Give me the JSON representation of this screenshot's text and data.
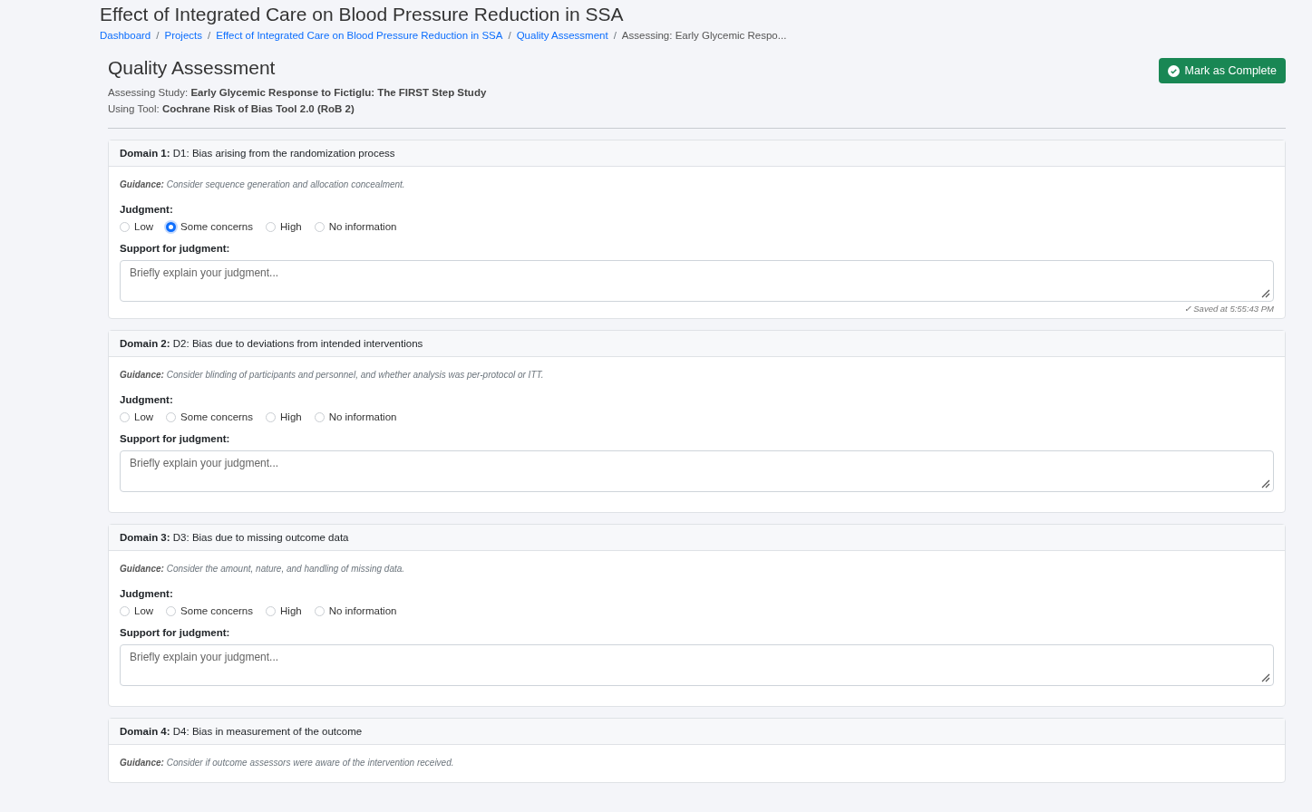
{
  "page_title": "Effect of Integrated Care on Blood Pressure Reduction in SSA",
  "breadcrumb": [
    {
      "label": "Dashboard",
      "link": true
    },
    {
      "separator": "/",
      "label": "Projects",
      "link": true
    },
    {
      "separator": "/",
      "label": "Effect of Integrated Care on Blood Pressure Reduction in SSA",
      "link": true
    },
    {
      "separator": "/",
      "label": "Quality Assessment",
      "link": true
    },
    {
      "separator": "/",
      "label": "Assessing: Early Glycemic Respo...",
      "link": false
    }
  ],
  "heading": "Quality Assessment",
  "study_line": {
    "label": "Assessing Study:",
    "value": "Early Glycemic Response to Fictiglu: The FIRST Step Study"
  },
  "tool_line": {
    "label": "Using Tool:",
    "value": "Cochrane Risk of Bias Tool 2.0 (RoB 2)"
  },
  "complete_button": "Mark as Complete",
  "domains": [
    {
      "label": "Domain 1:",
      "title": "D1: Bias arising from the randomization process",
      "guidance_label": "Guidance:",
      "guidance": "Consider sequence generation and allocation concealment.",
      "judgment_label": "Judgment:",
      "options": [
        {
          "label": "Low",
          "selected": false
        },
        {
          "label": "Some concerns",
          "selected": true
        },
        {
          "label": "High",
          "selected": false
        },
        {
          "label": "No information",
          "selected": false
        }
      ],
      "support_label": "Support for judgment:",
      "placeholder": "Briefly explain your judgment...",
      "saved": "✓ Saved at 5:55:43 PM"
    },
    {
      "label": "Domain 2:",
      "title": "D2: Bias due to deviations from intended interventions",
      "guidance_label": "Guidance:",
      "guidance": "Consider blinding of participants and personnel, and whether analysis was per-protocol or ITT.",
      "judgment_label": "Judgment:",
      "options": [
        {
          "label": "Low",
          "selected": false
        },
        {
          "label": "Some concerns",
          "selected": false
        },
        {
          "label": "High",
          "selected": false
        },
        {
          "label": "No information",
          "selected": false
        }
      ],
      "support_label": "Support for judgment:",
      "placeholder": "Briefly explain your judgment..."
    },
    {
      "label": "Domain 3:",
      "title": "D3: Bias due to missing outcome data",
      "guidance_label": "Guidance:",
      "guidance": "Consider the amount, nature, and handling of missing data.",
      "judgment_label": "Judgment:",
      "options": [
        {
          "label": "Low",
          "selected": false
        },
        {
          "label": "Some concerns",
          "selected": false
        },
        {
          "label": "High",
          "selected": false
        },
        {
          "label": "No information",
          "selected": false
        }
      ],
      "support_label": "Support for judgment:",
      "placeholder": "Briefly explain your judgment..."
    },
    {
      "label": "Domain 4:",
      "title": "D4: Bias in measurement of the outcome",
      "guidance_label": "Guidance:",
      "guidance": "Consider if outcome assessors were aware of the intervention received."
    }
  ]
}
